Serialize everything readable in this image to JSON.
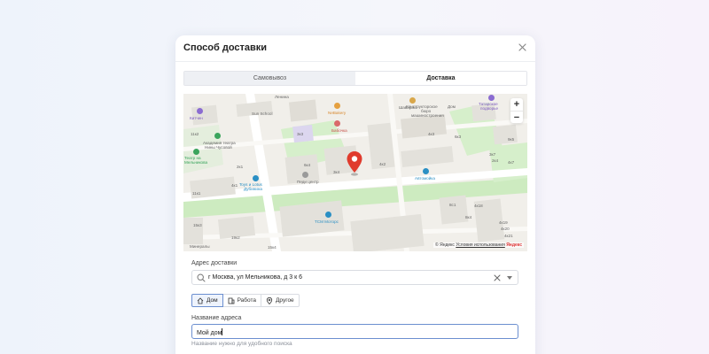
{
  "modal": {
    "title": "Способ доставки"
  },
  "tabs": [
    {
      "label": "Самовывоз",
      "active": false
    },
    {
      "label": "Доставка",
      "active": true
    }
  ],
  "map": {
    "copyright_prefix": "© Яндекс",
    "terms_link": "Условия использования",
    "brand": "Яндекс",
    "zoom_in": "+",
    "zoom_out": "−",
    "labels": {
      "lenin": "Ленина",
      "kitchen": "Китчен",
      "sun_school": "Sun School",
      "academy_1": "Академия театра",
      "academy_2": "Нины Чусовой",
      "theatre_1": "Театр на",
      "theatre_2": "Мельникова",
      "shavarma": "Шаварма",
      "nebakery": "NeBakery",
      "babochka": "Бабочка",
      "constructor_1": "Конструкторское",
      "constructor_2": "бюро",
      "constructor_3": "машиностроения",
      "house": "Дом",
      "tatarskoe_1": "Татарское",
      "tatarskoe_2": "подворье",
      "nb_3k3": "3к3",
      "nb_4k3": "4к3",
      "nb_6k3": "6к3",
      "nb_11k2": "11к2",
      "nb_9k5": "9к5",
      "nb_3k7": "3к7",
      "nb_2k4": "2к4",
      "nb_4k2": "4к2",
      "nb_4k7": "4к7",
      "nb_3k4": "3к4",
      "nb_6k4": "6к4",
      "nb_2k1": "2к1",
      "nb_4k1": "4к1",
      "nb_11k1": "11к1",
      "nb_8k4": "8к4",
      "nb_8c1": "8с1",
      "nb_4k18": "4к18",
      "nb_4k19": "4к19",
      "nb_15k3": "15к3",
      "nb_19k2": "19к2",
      "nb_15k4": "15к4",
      "nb_4k20": "4к20",
      "nb_4k21": "4к21",
      "pedicenter": "Педи центр",
      "toys_1": "Toys и Lotus",
      "toys_2": "Дубинина",
      "automoika": "Автомойка",
      "tsm": "ТСМ Моторс",
      "minerals": "Минералы"
    }
  },
  "address": {
    "label": "Адрес доставки",
    "value": "г Москва, ул Мельникова, д 3 к 6"
  },
  "address_types": [
    {
      "label": "Дом",
      "icon": "home-icon",
      "active": true
    },
    {
      "label": "Работа",
      "icon": "building-icon",
      "active": false
    },
    {
      "label": "Другое",
      "icon": "location-pin-icon",
      "active": false
    }
  ],
  "address_name": {
    "label": "Название адреса",
    "value": "Мой дом",
    "hint": "Название нужно для удобного поиска"
  },
  "colors": {
    "accent": "#6c8fd0",
    "pin": "#e03b2d",
    "park": "#cdebc0",
    "road": "#ffffff",
    "building": "#e3e1db"
  }
}
